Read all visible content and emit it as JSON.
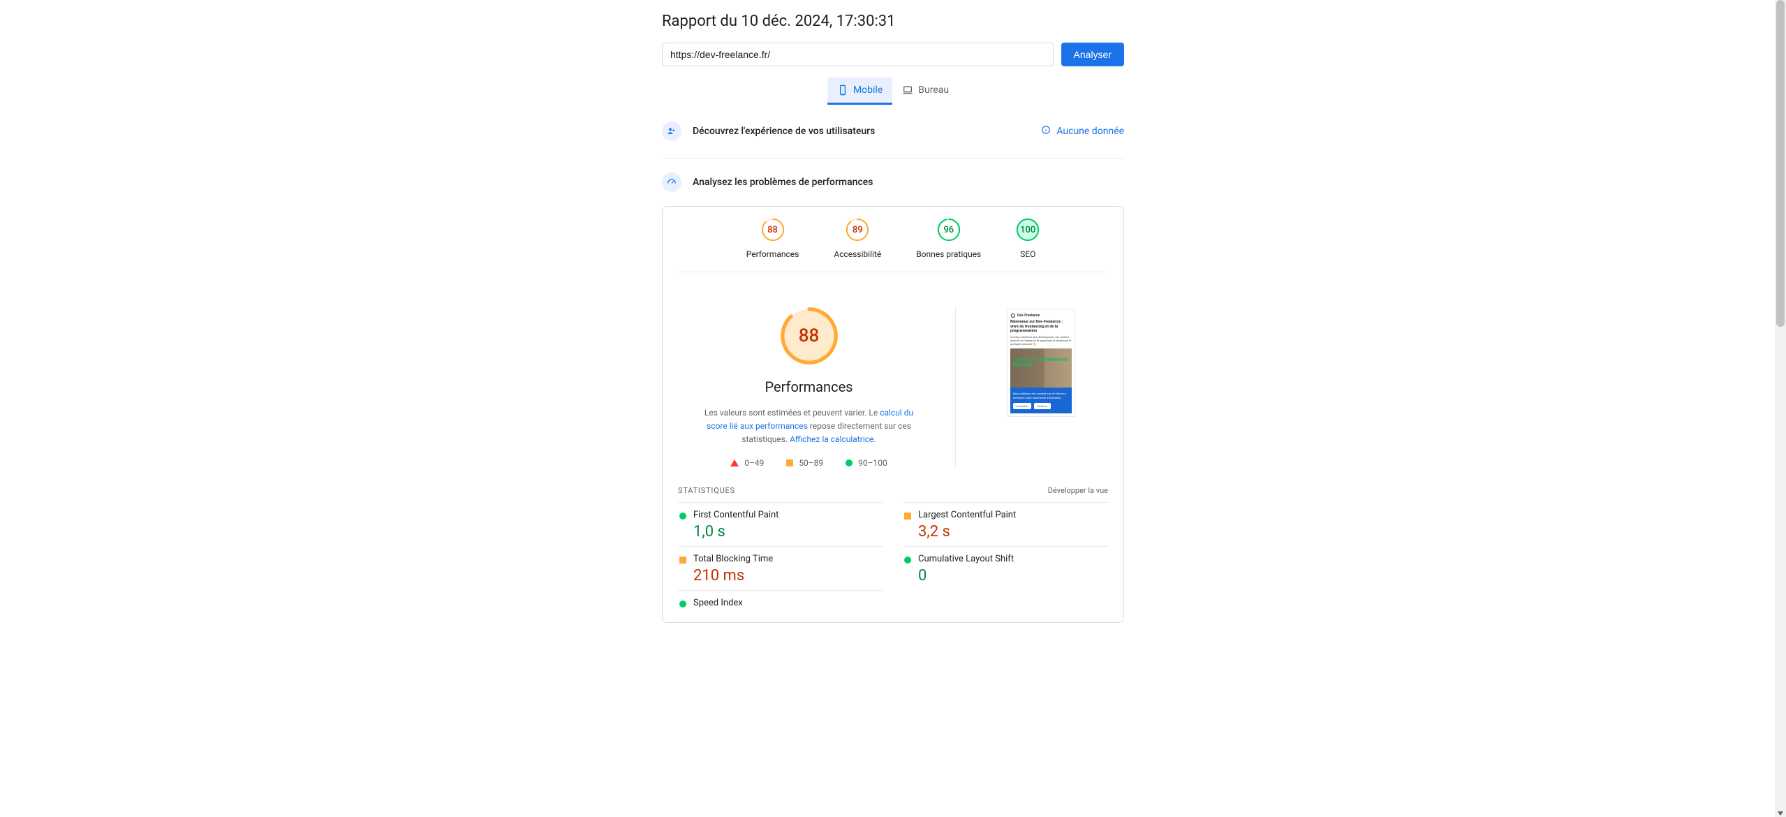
{
  "report_title": "Rapport du 10 déc. 2024, 17:30:31",
  "url_value": "https://dev-freelance.fr/",
  "analyse_label": "Analyser",
  "tabs": {
    "mobile": "Mobile",
    "desktop": "Bureau"
  },
  "user_exp": {
    "title": "Découvrez l'expérience de vos utilisateurs",
    "no_data": "Aucune donnée"
  },
  "perf_issues_title": "Analysez les problèmes de performances",
  "gauges": [
    {
      "score": "88",
      "label": "Performances",
      "color": "orange"
    },
    {
      "score": "89",
      "label": "Accessibilité",
      "color": "orange"
    },
    {
      "score": "96",
      "label": "Bonnes pratiques",
      "color": "green"
    },
    {
      "score": "100",
      "label": "SEO",
      "color": "green"
    }
  ],
  "big_gauge": {
    "score": "88",
    "title": "Performances"
  },
  "desc": {
    "before_link1": "Les valeurs sont estimées et peuvent varier. Le ",
    "link1": "calcul du score lié aux performances",
    "between": " repose directement sur ces statistiques. ",
    "link2": "Affichez la calculatrice"
  },
  "legend": {
    "red": "0–49",
    "orange": "50–89",
    "green": "90–100"
  },
  "preview": {
    "brand": "Dev-Freelance",
    "headline": "Bienvenue sur Dev-Freelance : vivre du freelancing et de la programmation",
    "sub": "Ce blog s'adresse aux développeurs qui veulent avancer en freelance et apprendre la technique et quelques astuces 👋",
    "overlay": "J'AI FAIT DU COWORKING EN BELGIQUE",
    "banner": "Nous utilisons des cookies sur ce site pour améliorer votre expérience d'utilisateur.",
    "accept": "Accepter",
    "refuse": "Refuser"
  },
  "stats": {
    "label": "STATISTIQUES",
    "expand": "Développer la vue"
  },
  "metrics": [
    {
      "name": "First Contentful Paint",
      "value": "1,0 s",
      "status": "green"
    },
    {
      "name": "Largest Contentful Paint",
      "value": "3,2 s",
      "status": "orange"
    },
    {
      "name": "Total Blocking Time",
      "value": "210 ms",
      "status": "orange"
    },
    {
      "name": "Cumulative Layout Shift",
      "value": "0",
      "status": "green"
    },
    {
      "name": "Speed Index",
      "value": "",
      "status": "green"
    }
  ],
  "colors": {
    "orange_stroke": "#fa3",
    "orange_bg": "#ffeacc",
    "green_stroke": "#0c6",
    "green_bg": "#ccffe6"
  }
}
